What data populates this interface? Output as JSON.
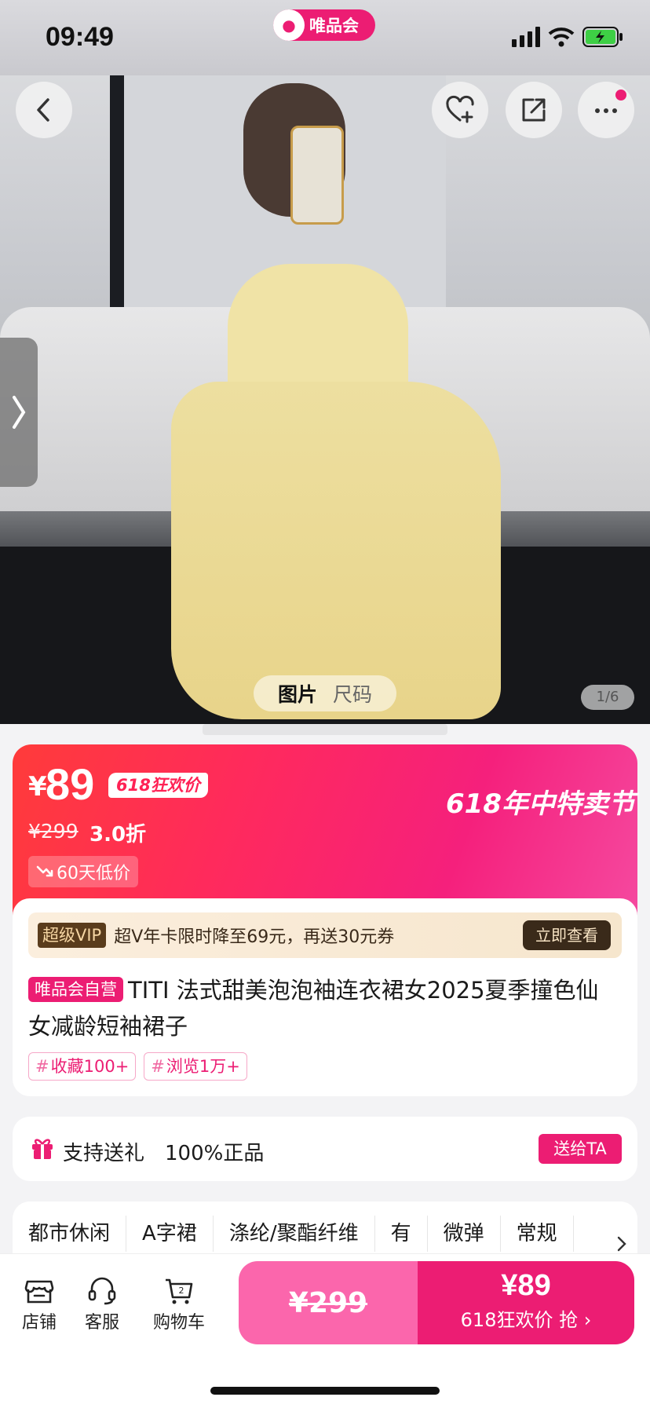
{
  "status": {
    "time": "09:49",
    "app_badge": "唯品会"
  },
  "hero": {
    "tabs": [
      "图片",
      "尺码"
    ],
    "counter": "1/6",
    "icons": [
      "back-icon",
      "favorite-add-icon",
      "share-icon",
      "more-icon"
    ]
  },
  "price": {
    "currency": "¥",
    "now": "89",
    "promo_tag": "618狂欢价",
    "festival": "618年中特卖节",
    "old": "¥299",
    "discount": "3.0折",
    "low_price": "60天低价"
  },
  "vip": {
    "tag": "超级VIP",
    "text": "超V年卡限时降至69元，再送30元券",
    "button": "立即查看"
  },
  "product": {
    "self_tag": "唯品会自营",
    "title": "TITI 法式甜美泡泡袖连衣裙女2025夏季撞色仙女减龄短袖裙子",
    "stats": [
      "收藏100+",
      "浏览1万+"
    ]
  },
  "gift": {
    "label": "支持送礼",
    "genuine": "100%正品",
    "button": "送给TA"
  },
  "attributes": [
    "都市休闲",
    "A字裙",
    "涤纶/聚酯纤维",
    "有",
    "微弹",
    "常规"
  ],
  "bottom": {
    "store": "店铺",
    "service": "客服",
    "cart": "购物车",
    "cart_count": "2",
    "original_price": "¥299",
    "buy_price": "¥89",
    "buy_label": "618狂欢价 抢"
  }
}
